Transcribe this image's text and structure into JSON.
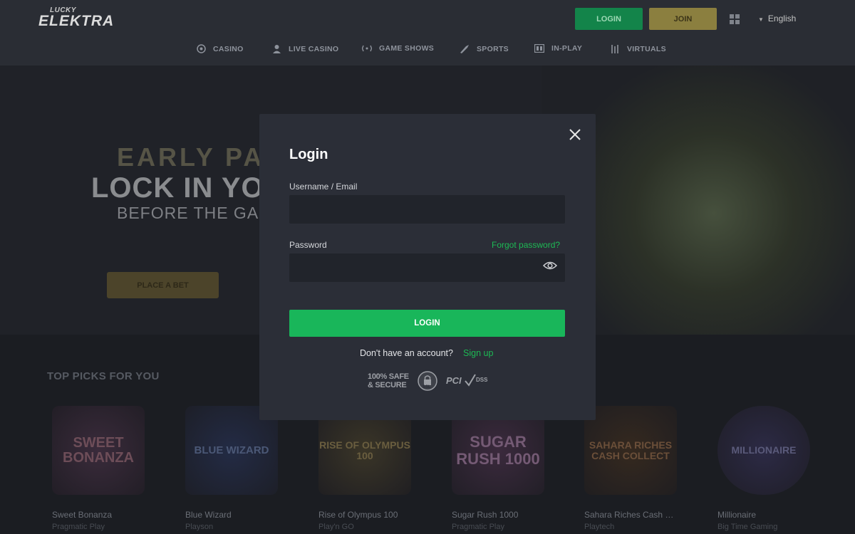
{
  "header": {
    "logo_top": "LUCKY",
    "logo_main": "ELEKTRA",
    "login_label": "LOGIN",
    "join_label": "JOIN",
    "language": "English",
    "nav": [
      {
        "label": "CASINO",
        "icon": "casino-chip-icon"
      },
      {
        "label": "LIVE CASINO",
        "icon": "live-dealer-icon"
      },
      {
        "label": "GAME SHOWS",
        "icon": "game-shows-icon"
      },
      {
        "label": "SPORTS",
        "icon": "sports-icon"
      },
      {
        "label": "IN-PLAY",
        "icon": "in-play-icon"
      },
      {
        "label": "VIRTUALS",
        "icon": "virtuals-icon"
      }
    ]
  },
  "hero": {
    "line1": "EARLY PA",
    "line2": "LOCK IN YOU",
    "line3": "BEFORE THE GAM",
    "button_label": "PLACE A BET"
  },
  "picks": {
    "title": "TOP PICKS FOR YOU",
    "games": [
      {
        "name": "Sweet Bonanza",
        "provider": "Pragmatic Play",
        "art": "SWEET BONANZA"
      },
      {
        "name": "Blue Wizard",
        "provider": "Playson",
        "art": "BLUE WIZARD"
      },
      {
        "name": "Rise of Olympus 100",
        "provider": "Play'n GO",
        "art": "RISE OF OLYMPUS 100"
      },
      {
        "name": "Sugar Rush 1000",
        "provider": "Pragmatic Play",
        "art": "SUGAR RUSH 1000"
      },
      {
        "name": "Sahara Riches Cash Collect",
        "provider": "Playtech",
        "art": "SAHARA RICHES CASH COLLECT"
      },
      {
        "name": "Millionaire",
        "provider": "Big Time Gaming",
        "art": "MILLIONAIRE"
      }
    ]
  },
  "modal": {
    "title": "Login",
    "username_label": "Username / Email",
    "username_value": "",
    "password_label": "Password",
    "password_value": "",
    "forgot_label": "Forgot password?",
    "login_button": "LOGIN",
    "no_account_text": "Don't have an account?",
    "signup_label": "Sign up",
    "badge_safe": "100% SAFE & SECURE",
    "badge_ssl": "SSL",
    "badge_pci": "PCI",
    "badge_dss": "DSS"
  },
  "colors": {
    "accent_green": "#19b65a",
    "link_green": "#1db954",
    "join_gold": "#8b7f3f",
    "modal_bg": "#2b2e37",
    "input_bg": "#21242b"
  }
}
